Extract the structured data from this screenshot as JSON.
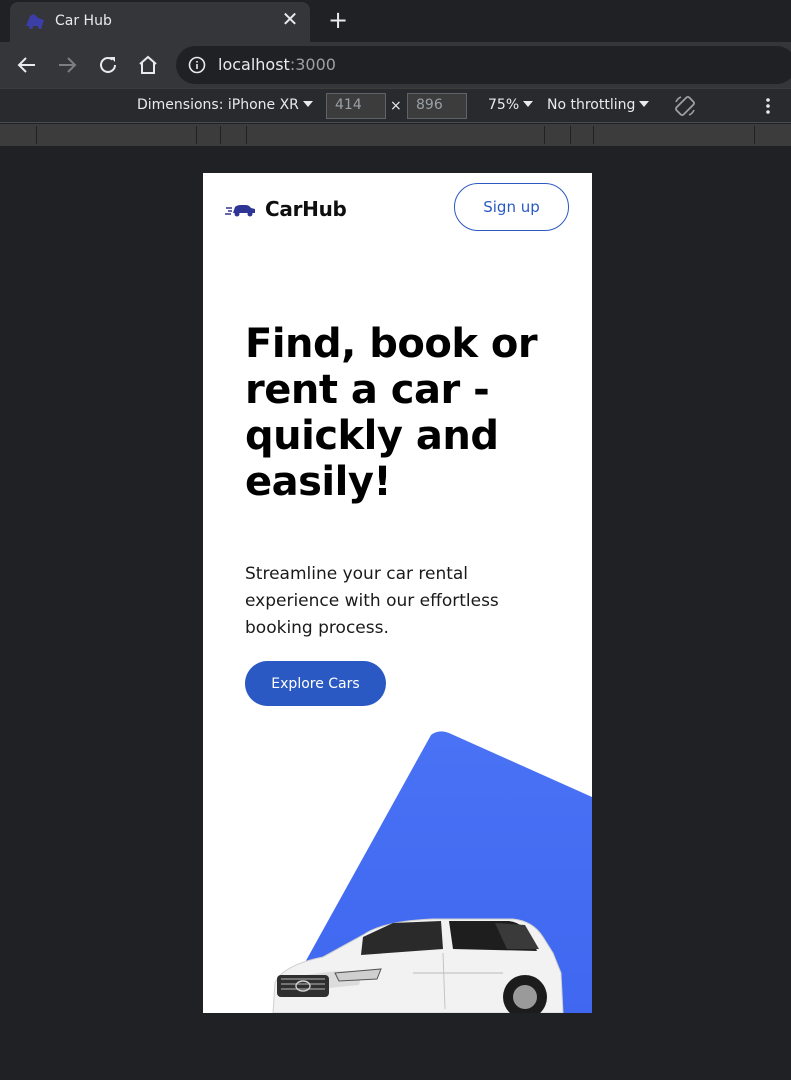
{
  "browser": {
    "tab_title": "Car Hub",
    "tab_close": "✕",
    "new_tab": "+",
    "url_host": "localhost",
    "url_port": ":3000"
  },
  "devtools": {
    "device_label": "Dimensions: iPhone XR",
    "width": "414",
    "height": "896",
    "times": "×",
    "zoom": "75%",
    "throttling": "No throttling"
  },
  "app": {
    "brand": "CarHub",
    "signup_label": "Sign up",
    "hero_title": "Find, book or rent a car - quickly and easily!",
    "hero_subtitle": "Streamline your car rental experience with our effortless booking process.",
    "explore_label": "Explore Cars",
    "colors": {
      "primary": "#2b59c3",
      "hero_shape": "#4a72f5"
    }
  }
}
